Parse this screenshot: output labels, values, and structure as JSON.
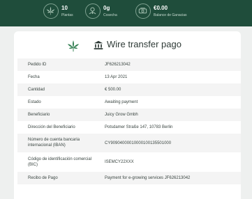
{
  "stats": [
    {
      "value": "10",
      "label": "Plantas",
      "icon": "cannabis-leaf-icon"
    },
    {
      "value": "0g",
      "label": "Cosecha",
      "icon": "harvest-icon"
    },
    {
      "value": "€0.00",
      "label": "Balance de Ganacias",
      "icon": "money-icon"
    }
  ],
  "header": {
    "title": "Wire transfer pago"
  },
  "details": [
    {
      "label": "Pedido ID",
      "value": "JF626213042"
    },
    {
      "label": "Fecha",
      "value": "13 Apr 2021"
    },
    {
      "label": "Cantidad",
      "value": "€ 500.00"
    },
    {
      "label": "Estado",
      "value": "Awaiting payment"
    },
    {
      "label": "Beneficiario",
      "value": "Juicy Grow Gmbh"
    },
    {
      "label": "Dirección del Beneficiario",
      "value": "Potsdamer Straße 147, 10783 Berlin"
    },
    {
      "label": "Número de cuenta bancaria internacional (IBAN)",
      "value": "CY90904000010000100135501000"
    },
    {
      "label": "Código de identificación comercial (BIC)",
      "value": "ISEMCY22XXX"
    },
    {
      "label": "Recibo de Pago",
      "value": "Payment for e-growing services JF626213042"
    }
  ],
  "colors": {
    "topbar": "#1f4d3b",
    "accent": "#2f7d4f",
    "page_bg": "#eef0ef"
  }
}
